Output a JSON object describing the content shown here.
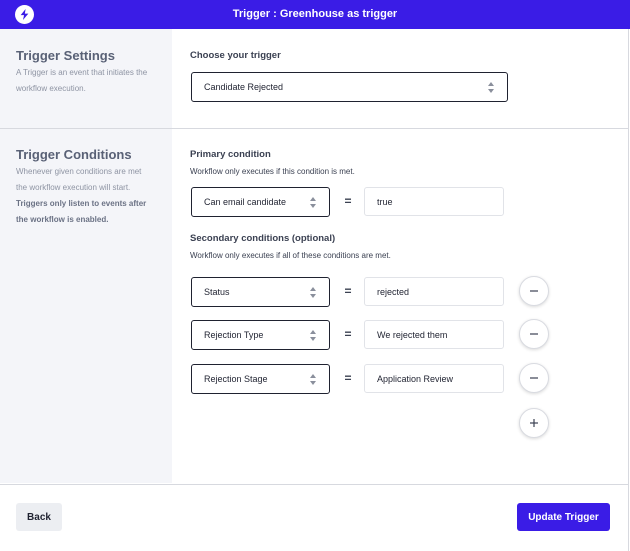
{
  "window": {
    "title": "Trigger : Greenhouse as trigger",
    "logo_icon": "lightning-bolt-icon",
    "accent_color": "#3a1ce6"
  },
  "settings": {
    "title": "Trigger Settings",
    "description": "A Trigger is an event that initiates the workflow execution."
  },
  "choose_trigger": {
    "label": "Choose your trigger",
    "selected": "Candidate Rejected"
  },
  "conditions_info": {
    "title": "Trigger Conditions",
    "description_plain": "Whenever given conditions are met the workflow execution will start.",
    "description_bold": "Triggers only listen to events after the workflow is enabled."
  },
  "primary": {
    "label": "Primary condition",
    "help": "Workflow only executes if this condition is met.",
    "field": "Can email candidate",
    "operator": "=",
    "value": "true"
  },
  "secondary": {
    "label": "Secondary conditions (optional)",
    "help": "Workflow only executes if all of these conditions are met.",
    "rows": [
      {
        "field": "Status",
        "operator": "=",
        "value": "rejected"
      },
      {
        "field": "Rejection Type",
        "operator": "=",
        "value": "We rejected them"
      },
      {
        "field": "Rejection Stage",
        "operator": "=",
        "value": "Application Review"
      }
    ],
    "remove_icon": "minus-icon",
    "add_icon": "plus-icon"
  },
  "footer": {
    "back_label": "Back",
    "update_label": "Update Trigger"
  }
}
